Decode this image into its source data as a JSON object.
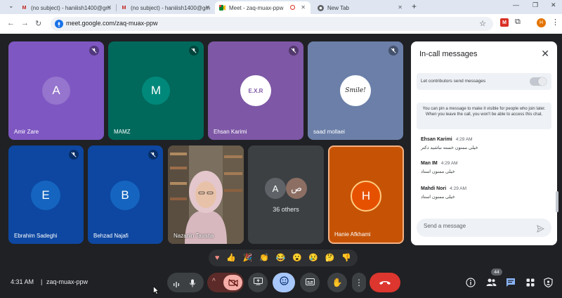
{
  "browser": {
    "tabs": [
      {
        "title": "(no subject) - haniiish1400@gm",
        "favicon": "gmail-icon"
      },
      {
        "title": "(no subject) - haniiish1400@gm",
        "favicon": "gmail-icon"
      },
      {
        "title": "Meet - zaq-muax-ppw",
        "favicon": "meet-icon",
        "active": true
      },
      {
        "title": "New Tab",
        "favicon": "chrome-icon"
      }
    ],
    "url": "meet.google.com/zaq-muax-ppw",
    "profile_initial": "H"
  },
  "participants": [
    {
      "name": "Amir Zare",
      "initial": "A",
      "tile_color": "#7e57c2",
      "avatar_color": "#9575cd",
      "muted": true
    },
    {
      "name": "MAMZ",
      "initial": "M",
      "tile_color": "#00695c",
      "avatar_color": "#00897b",
      "muted": true
    },
    {
      "name": "Ehsan Karimi",
      "initial": "E.X.R",
      "tile_color": "#7e57a6",
      "avatar_color": "#ffffff",
      "muted": true
    },
    {
      "name": "saad mollaei",
      "initial": "Smile!",
      "tile_color": "#6b7fa8",
      "avatar_color": "#ffffff",
      "muted": true
    },
    {
      "name": "Ebrahim Sadeghi",
      "initial": "E",
      "tile_color": "#0d47a1",
      "avatar_color": "#1565c0",
      "muted": true
    },
    {
      "name": "Behzad Najafi",
      "initial": "B",
      "tile_color": "#0d47a1",
      "avatar_color": "#1565c0",
      "muted": true
    },
    {
      "name": "Nazanin Tavana",
      "initial": "",
      "tile_color": "#8a8070",
      "avatar_color": "#d9c2c2",
      "muted": false
    },
    {
      "name": "Hanie Afkhami",
      "initial": "H",
      "tile_color": "#d35400",
      "avatar_color": "#e65100",
      "muted": false
    }
  ],
  "others": {
    "label": "36 others",
    "initials": [
      "A",
      "ص"
    ]
  },
  "chat": {
    "title": "In-call messages",
    "toggle_label": "Let contributors send messages",
    "pin_note": "You can pin a message to make it visible for people who join later. When you leave the call, you won't be able to access this chat.",
    "messages": [
      {
        "sender": "Ehsan Karimi",
        "time": "4:29 AM",
        "text": "خیلی ممنون خسته نباشید دکتر"
      },
      {
        "sender": "Man IM",
        "time": "4:29 AM",
        "text": "خیلی ممنون استاد"
      },
      {
        "sender": "Mahdi Nori",
        "time": "4:29 AM",
        "text": "خیلی ممنون استاد"
      }
    ],
    "input_placeholder": "Send a message"
  },
  "reactions": [
    "♥",
    "👍",
    "🎉",
    "👏",
    "😂",
    "😮",
    "😢",
    "🤔",
    "👎"
  ],
  "footer": {
    "time": "4:31 AM",
    "separator": "|",
    "meeting_code": "zaq-muax-ppw",
    "people_count": "44"
  }
}
